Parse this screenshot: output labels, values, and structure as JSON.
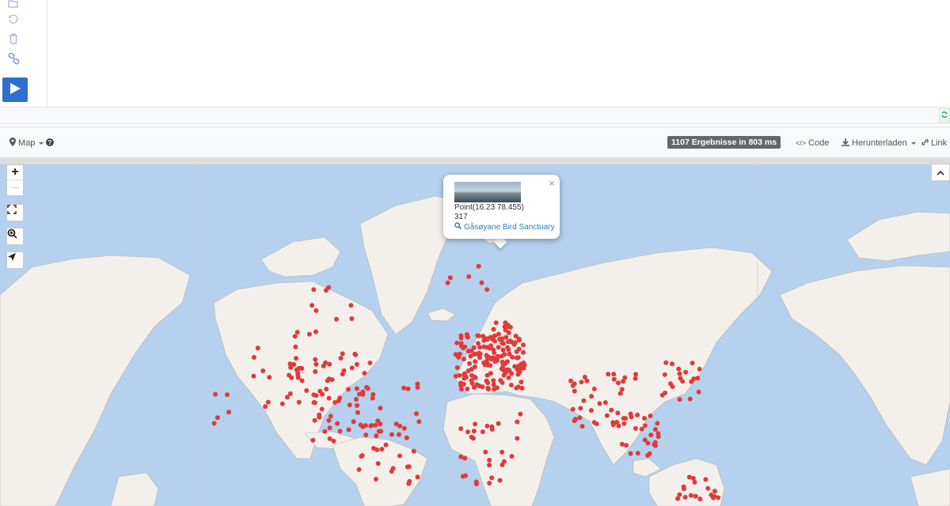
{
  "editor": {
    "gutter_icons": [
      "folder-open-icon",
      "undo-icon",
      "trash-icon",
      "link-icon"
    ],
    "run_button": "play-icon"
  },
  "toolbar": {
    "map_label": "Map",
    "result_badge": "1107 Ergebnisse in 803 ms",
    "code_label": "Code",
    "download_label": "Herunterladen",
    "link_label": "Link"
  },
  "map": {
    "zoom_in_label": "+",
    "zoom_out_label": "—",
    "marker_color": "#e03a3a",
    "water_color": "#b5d1ee",
    "land_color": "#f3f0ec"
  },
  "popup": {
    "line1": "Point(16.23 78.455)",
    "line2": "317",
    "link_text": "Gåsøyane Bird Sanctuary",
    "close_label": "×"
  }
}
